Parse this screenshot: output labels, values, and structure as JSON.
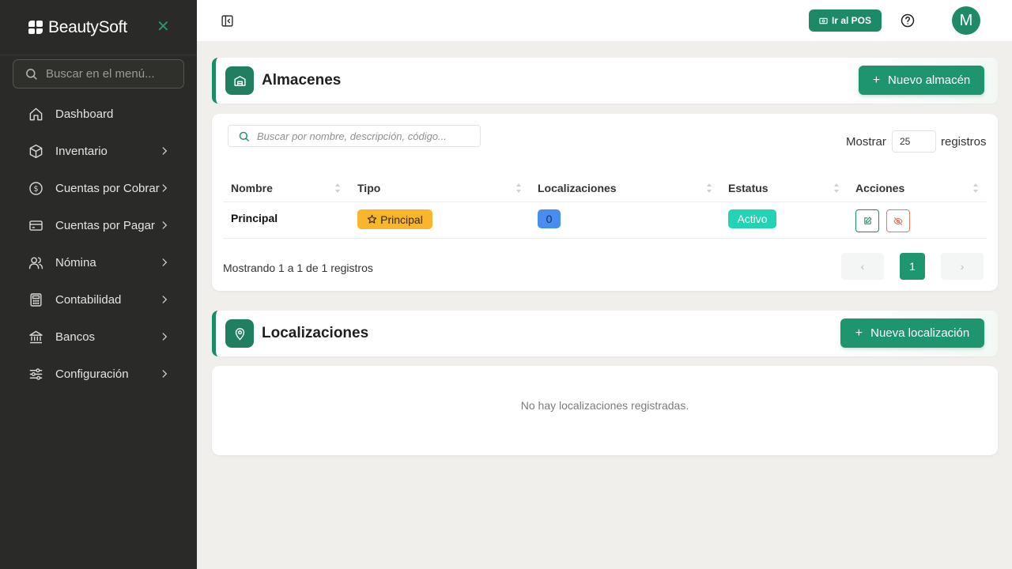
{
  "brand": {
    "name": "BeautySoft",
    "close_icon": "close-icon"
  },
  "sidebar": {
    "search_placeholder": "Buscar en el menú...",
    "items": [
      {
        "label": "Dashboard",
        "icon": "home-icon",
        "has_children": false
      },
      {
        "label": "Inventario",
        "icon": "box-icon",
        "has_children": true
      },
      {
        "label": "Cuentas por Cobrar",
        "icon": "dollar-circle-icon",
        "has_children": true
      },
      {
        "label": "Cuentas por Pagar",
        "icon": "credit-card-icon",
        "has_children": true
      },
      {
        "label": "Nómina",
        "icon": "users-icon",
        "has_children": true
      },
      {
        "label": "Contabilidad",
        "icon": "calculator-icon",
        "has_children": true
      },
      {
        "label": "Bancos",
        "icon": "bank-icon",
        "has_children": true
      },
      {
        "label": "Configuración",
        "icon": "sliders-icon",
        "has_children": true
      }
    ]
  },
  "topbar": {
    "pos_button": "Ir al POS",
    "help_icon": "help-circle-icon",
    "avatar_initial": "M"
  },
  "almacenes": {
    "title": "Almacenes",
    "new_button": "Nuevo almacén",
    "search_placeholder": "Buscar por nombre, descripción, código...",
    "show_label": "Mostrar",
    "page_size": "25",
    "records_label": "registros",
    "columns": [
      "Nombre",
      "Tipo",
      "Localizaciones",
      "Estatus",
      "Acciones"
    ],
    "rows": [
      {
        "nombre": "Principal",
        "tipo": "Principal",
        "localizaciones": "0",
        "estatus": "Activo"
      }
    ],
    "info": "Mostrando 1 a 1 de 1 registros",
    "pagination": {
      "prev": "‹",
      "current": "1",
      "next": "›"
    }
  },
  "localizaciones": {
    "title": "Localizaciones",
    "new_button": "Nueva localización",
    "empty_message": "No hay localizaciones registradas."
  },
  "colors": {
    "accent": "#1e946f",
    "sidebar_bg": "#2a2a28",
    "warning": "#f7b62b",
    "info": "#4a8df0",
    "success": "#22d4b4",
    "danger": "#e07a5f"
  }
}
